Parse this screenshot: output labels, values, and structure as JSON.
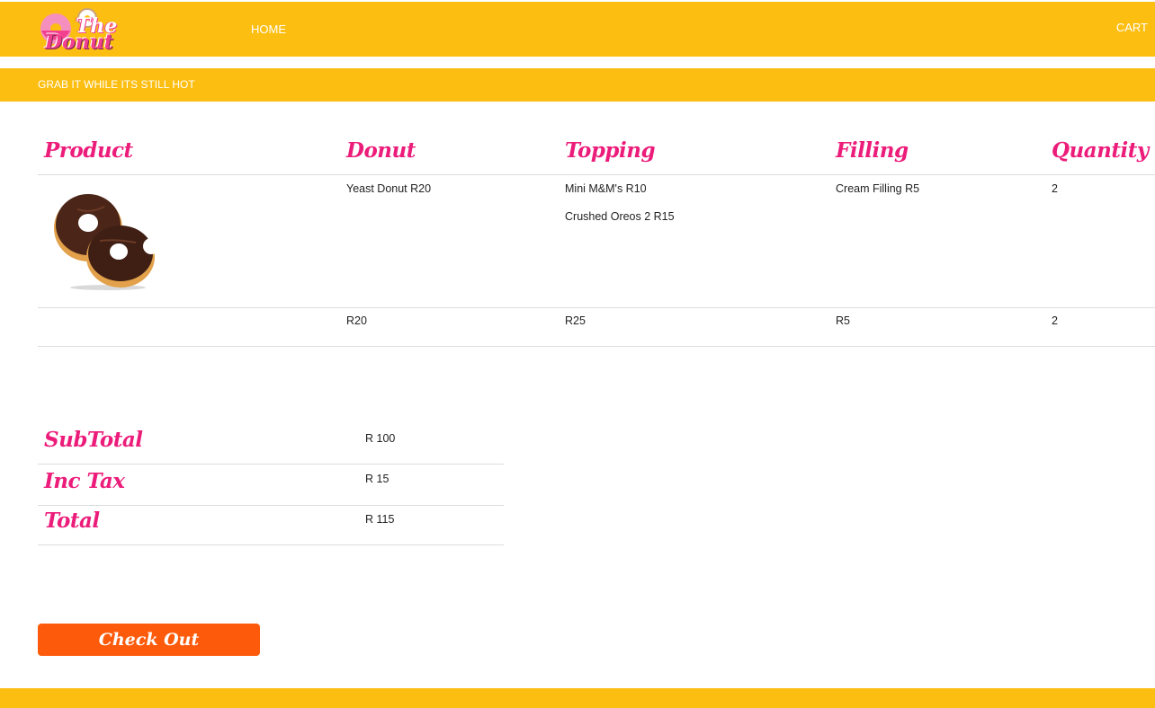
{
  "header": {
    "logo": "The Donut",
    "logo_line1": "The",
    "logo_line2": "Donut",
    "nav_home": "HOME",
    "nav_cart": "CART"
  },
  "banner": {
    "text": "GRAB IT WHILE ITS STILL HOT"
  },
  "table": {
    "headers": [
      "Product",
      "Donut",
      "Topping",
      "Filling",
      "Quantity"
    ],
    "row": {
      "donut": "Yeast Donut  R20",
      "toppings": [
        "Mini M&M's  R10",
        "Crushed Oreos 2  R15"
      ],
      "filling": "Cream Filling  R5",
      "quantity": "2"
    },
    "totals_row": {
      "donut": "R20",
      "topping": "R25",
      "filling": "R5",
      "quantity": "2"
    }
  },
  "summary": {
    "subtotal_label": "SubTotal",
    "subtotal_value": "R 100",
    "tax_label": "Inc Tax",
    "tax_value": "R 15",
    "total_label": "Total",
    "total_value": "R 115"
  },
  "checkout_label": "Check Out",
  "colors": {
    "brand_yellow": "#fdbe12",
    "accent_pink": "#ec1c7a",
    "button_orange": "#fd5b0b"
  }
}
